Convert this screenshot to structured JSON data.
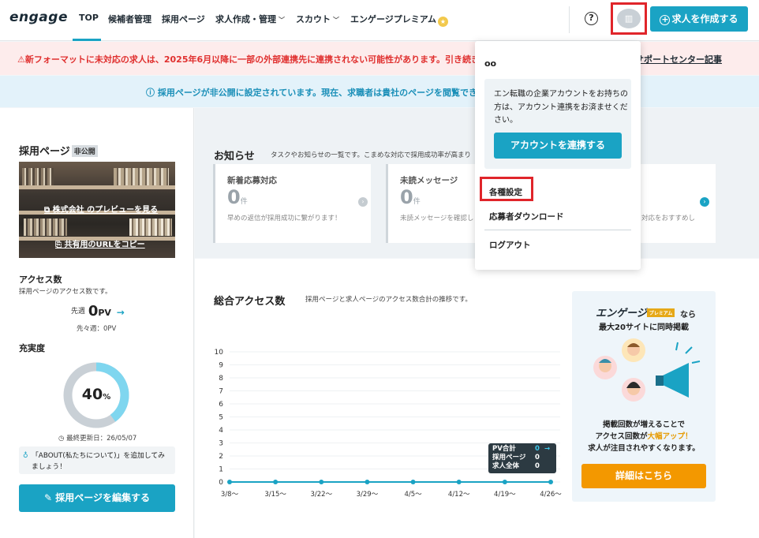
{
  "nav": {
    "logo": "engage",
    "items": [
      "TOP",
      "候補者管理",
      "採用ページ",
      "求人作成・管理",
      "スカウト",
      "エンゲージプレミアム"
    ],
    "create_button": "求人を作成する",
    "help": "?"
  },
  "alerts": {
    "red": "⚠新フォーマットに未対応の求人は、2025年6月以降に一部の外部連携先に連携されない可能性があります。引き続き求人",
    "red_link": "サポートセンター記事",
    "blue": "ⓘ 採用ページが非公開に設定されています。現在、求職者は貴社のページを閲覧できませ"
  },
  "sidebar": {
    "title": "採用ページ",
    "badge": "非公開",
    "preview_link": "株式会社 のプレビューを見る",
    "share_link": "共有用のURLをコピー",
    "access_title": "アクセス数",
    "access_desc": "採用ページのアクセス数です。",
    "last_week_label": "先週",
    "last_week_value": "0",
    "pv_unit": "PV",
    "prev_week": "先々週：0PV",
    "completeness_title": "充実度",
    "completeness_value": "40",
    "completeness_unit": "%",
    "completeness_fraction": 0.4,
    "updated": "最終更新日：26/05/07",
    "tip": "「ABOUT(私たちについて)」を追加してみましょう！",
    "edit_button": "採用ページを編集する"
  },
  "notices": {
    "title": "お知らせ",
    "desc": "タスクやお知らせの一覧です。こまめな対応で採用成功率が高まり",
    "cards": [
      {
        "title": "新着応募対応",
        "count": "0",
        "unit": "件",
        "desc": "早めの返信が採用成功に繋がります！"
      },
      {
        "title": "未読メッセージ",
        "count": "0",
        "unit": "件",
        "desc": "未読メッセージを確認し"
      },
      {
        "desc": "対応をおすすめし"
      }
    ]
  },
  "access": {
    "title": "総合アクセス数",
    "desc": "採用ページと求人ページのアクセス数合計の推移です。"
  },
  "chart_data": {
    "type": "line",
    "title": "総合アクセス数",
    "x": [
      "3/8〜",
      "3/15〜",
      "3/22〜",
      "3/29〜",
      "4/5〜",
      "4/12〜",
      "4/19〜",
      "4/26〜"
    ],
    "series": [
      {
        "values": [
          0,
          0,
          0,
          0,
          0,
          0,
          0,
          0
        ]
      }
    ],
    "ylim": [
      0,
      10
    ],
    "yticks": [
      0,
      1,
      2,
      3,
      4,
      5,
      6,
      7,
      8,
      9,
      10
    ],
    "grid": true,
    "color": "#1aa3c4"
  },
  "tooltip": {
    "rows": [
      {
        "label": "PV合計",
        "value": "0"
      },
      {
        "label": "採用ページ",
        "value": "0"
      },
      {
        "label": "求人全体",
        "value": "0"
      }
    ]
  },
  "promo": {
    "logo": "エンゲージ",
    "premium": "プレミアム",
    "nara": "なら",
    "sub": "最大20サイトに同時掲載",
    "line1": "掲載回数が増えることで",
    "line2a": "アクセス回数が",
    "line2b": "大幅アップ！",
    "line3": "求人が注目されやすくなります。",
    "button": "詳細はこちら"
  },
  "dropdown": {
    "user": "oo",
    "panel_text": "エン転職の企業アカウントをお持ちの方は、アカウント連携をお済ませください。",
    "link_button": "アカウントを連携する",
    "items": [
      "各種設定",
      "応募者ダウンロード",
      "ログアウト"
    ]
  },
  "colors": {
    "accent": "#1aa3c4",
    "alert": "#e0302f",
    "highlight": "#e0252a",
    "promo_button": "#f39800"
  }
}
